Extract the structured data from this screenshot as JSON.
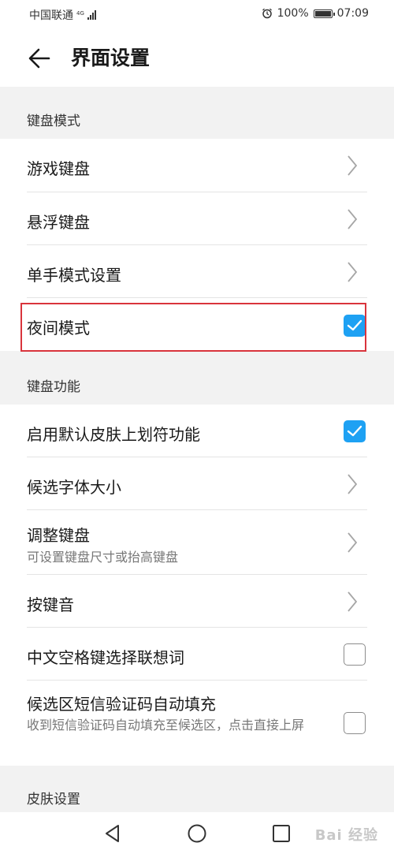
{
  "status_bar": {
    "carrier": "中国联通",
    "network": "4G",
    "battery": "100%",
    "time": "07:09"
  },
  "header": {
    "title": "界面设置"
  },
  "sections": {
    "keyboard_mode": {
      "header": "键盘模式",
      "items": [
        {
          "label": "游戏键盘",
          "control": "chevron"
        },
        {
          "label": "悬浮键盘",
          "control": "chevron"
        },
        {
          "label": "单手模式设置",
          "control": "chevron"
        },
        {
          "label": "夜间模式",
          "control": "checkbox",
          "checked": true,
          "highlighted": true
        }
      ]
    },
    "keyboard_functions": {
      "header": "键盘功能",
      "items": [
        {
          "label": "启用默认皮肤上划符功能",
          "control": "checkbox",
          "checked": true
        },
        {
          "label": "候选字体大小",
          "control": "chevron"
        },
        {
          "label": "调整键盘",
          "sublabel": "可设置键盘尺寸或抬高键盘",
          "control": "chevron"
        },
        {
          "label": "按键音",
          "control": "chevron"
        },
        {
          "label": "中文空格键选择联想词",
          "control": "checkbox",
          "checked": false
        },
        {
          "label": "候选区短信验证码自动填充",
          "sublabel": "收到短信验证码自动填充至候选区，点击直接上屏",
          "control": "checkbox",
          "checked": false
        }
      ]
    },
    "skin_settings": {
      "header": "皮肤设置"
    }
  },
  "nav_bar": {
    "buttons": [
      "back",
      "home",
      "recents"
    ]
  },
  "watermark": "Bai 经验",
  "colors": {
    "accent": "#1ea1f3",
    "highlight_box": "#d9343c",
    "background": "#f2f2f2"
  }
}
